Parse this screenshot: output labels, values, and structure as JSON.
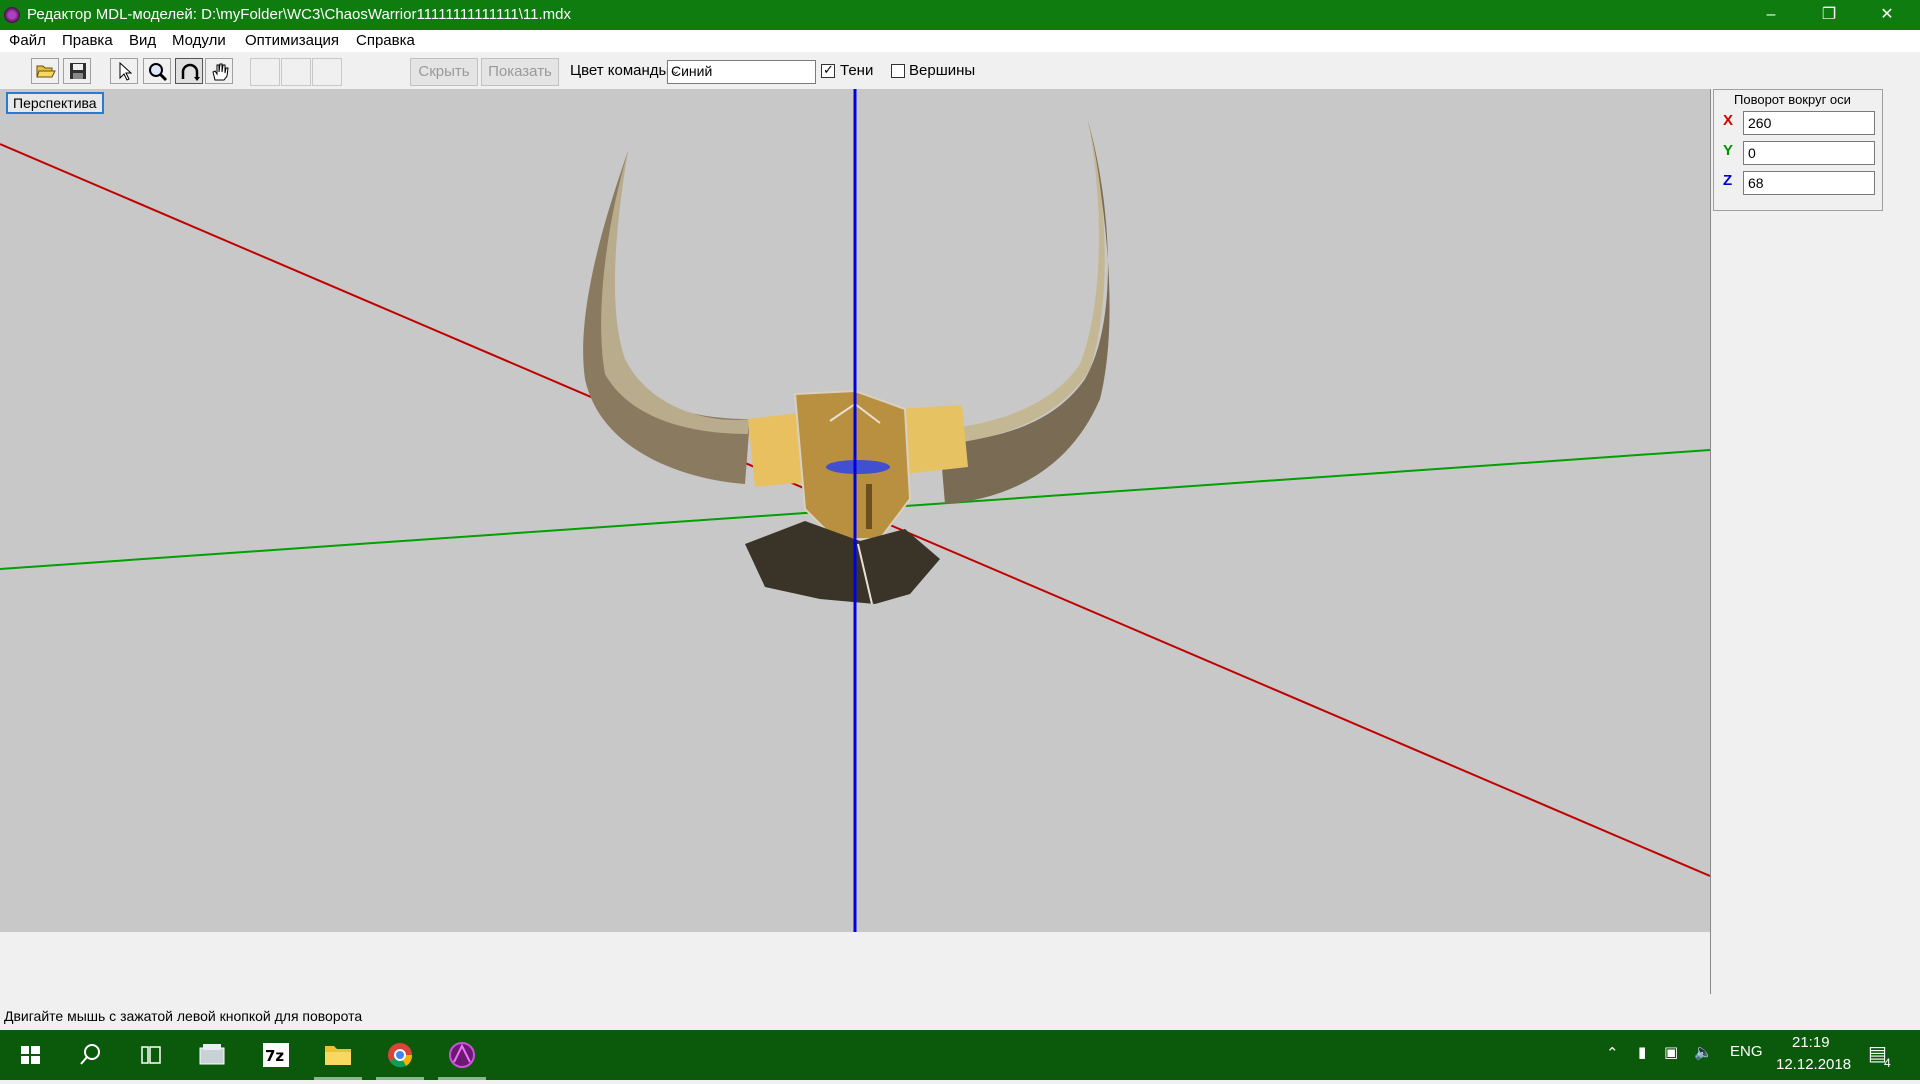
{
  "window": {
    "title": "Редактор MDL-моделей: D:\\myFolder\\WC3\\ChaosWarrior11111111111111\\11.mdx",
    "minimize_icon": "minimize-icon",
    "maximize_icon": "restore-icon",
    "close_icon": "close-icon"
  },
  "menu": [
    "Файл",
    "Правка",
    "Вид",
    "Модули",
    "Оптимизация",
    "Справка"
  ],
  "toolbar": {
    "hide_label": "Скрыть",
    "show_label": "Показать",
    "team_color_label": "Цвет команды:",
    "team_color_value": "Синий",
    "shadows_label": "Тени",
    "shadows_checked": true,
    "vertices_label": "Вершины",
    "vertices_checked": false
  },
  "viewport": {
    "mode_label": "Перспектива",
    "background": "#c8c8c8",
    "axis_colors": {
      "x": "#c00000",
      "y": "#00a000",
      "z": "#0000dd"
    }
  },
  "rotation": {
    "title": "Поворот вокруг оси",
    "x_label": "X",
    "x_value": "260",
    "y_label": "Y",
    "y_value": "0",
    "z_label": "Z",
    "z_value": "68"
  },
  "status": {
    "hint": "Двигайте мышь с зажатой левой кнопкой для поворота"
  },
  "taskbar": {
    "lang": "ENG",
    "time": "21:19",
    "date": "12.12.2018",
    "notifications": "4"
  }
}
